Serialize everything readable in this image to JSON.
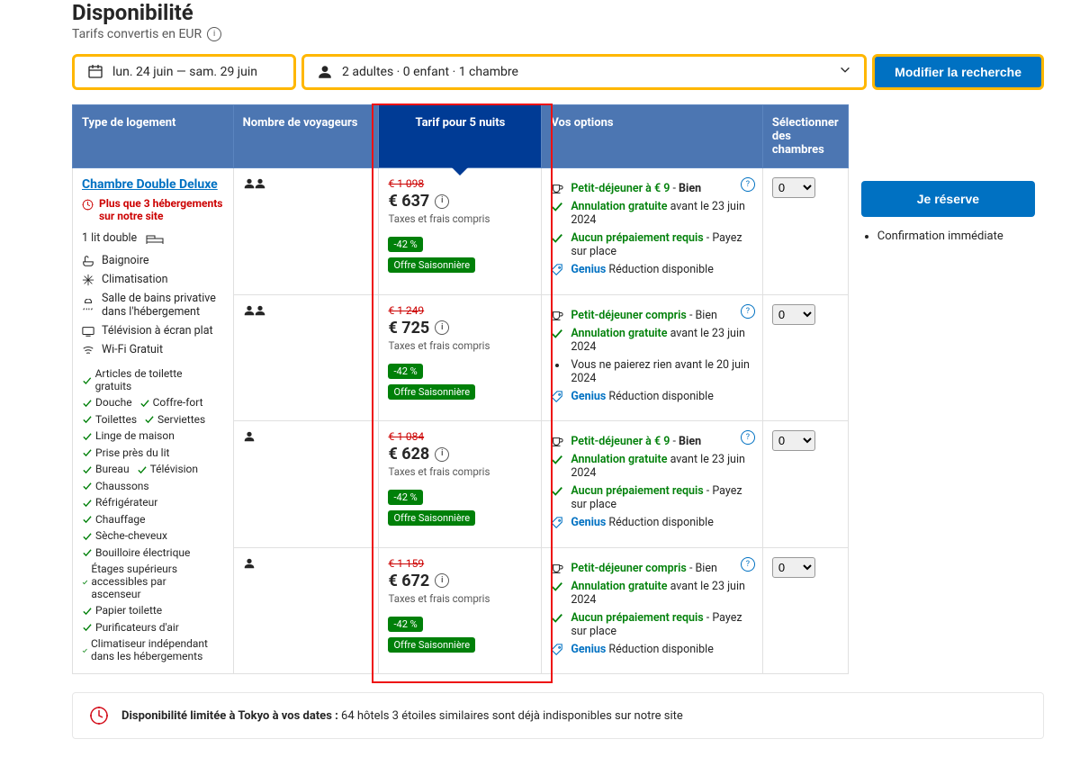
{
  "header": {
    "title": "Disponibilité",
    "subtitle": "Tarifs convertis en EUR"
  },
  "search": {
    "dates": "lun. 24 juin  —  sam. 29 juin",
    "guests": "2 adultes · 0 enfant · 1 chambre",
    "button": "Modifier la recherche"
  },
  "columns": {
    "type": "Type de logement",
    "occ": "Nombre de voyageurs",
    "price": "Tarif pour 5 nuits",
    "options": "Vos options",
    "select": "Sélectionner des chambres"
  },
  "room": {
    "name": "Chambre Double Deluxe",
    "scarcity": "Plus que 3 hébergements sur notre site",
    "bed": "1 lit double",
    "facilities": [
      "Baignoire",
      "Climatisation",
      "Salle de bains privative dans l'hébergement",
      "Télévision à écran plat",
      "Wi-Fi Gratuit"
    ],
    "amenities": [
      "Articles de toilette gratuits",
      "Douche",
      "Coffre-fort",
      "Toilettes",
      "Serviettes",
      "Linge de maison",
      "Prise près du lit",
      "Bureau",
      "Télévision",
      "Chaussons",
      "Réfrigérateur",
      "Chauffage",
      "Sèche-cheveux",
      "Bouilloire électrique",
      "Étages supérieurs accessibles par ascenseur",
      "Papier toilette",
      "Purificateurs d'air",
      "Climatiseur indépendant dans les hébergements"
    ]
  },
  "rates": [
    {
      "occupancy": 2,
      "old": "€ 1 098",
      "now": "€ 637",
      "tax": "Taxes et frais compris",
      "discount": "-42 %",
      "deal": "Offre Saisonnière",
      "options": [
        {
          "icon": "cup",
          "green": "Petit-déjeuner à € 9",
          "plain": " - ",
          "bold": "Bien"
        },
        {
          "icon": "check",
          "green": "Annulation gratuite",
          "plain": " avant le 23 juin 2024"
        },
        {
          "icon": "check",
          "green": "Aucun prépaiement requis",
          "plain": " - Payez sur place"
        },
        {
          "icon": "tag",
          "genius": "Genius",
          "plain": " Réduction disponible"
        }
      ]
    },
    {
      "occupancy": 2,
      "old": "€ 1 249",
      "now": "€ 725",
      "tax": "Taxes et frais compris",
      "discount": "-42 %",
      "deal": "Offre Saisonnière",
      "options": [
        {
          "icon": "cup",
          "green": "Petit-déjeuner compris",
          "plain": " - Bien"
        },
        {
          "icon": "check",
          "green": "Annulation gratuite",
          "plain": " avant le 23 juin 2024"
        },
        {
          "icon": "dot",
          "plain": "Vous ne paierez rien avant le 20 juin 2024"
        },
        {
          "icon": "tag",
          "genius": "Genius",
          "plain": " Réduction disponible"
        }
      ]
    },
    {
      "occupancy": 1,
      "old": "€ 1 084",
      "now": "€ 628",
      "tax": "Taxes et frais compris",
      "discount": "-42 %",
      "deal": "Offre Saisonnière",
      "options": [
        {
          "icon": "cup",
          "green": "Petit-déjeuner à € 9",
          "plain": " - ",
          "bold": "Bien"
        },
        {
          "icon": "check",
          "green": "Annulation gratuite",
          "plain": " avant le 23 juin 2024"
        },
        {
          "icon": "check",
          "green": "Aucun prépaiement requis",
          "plain": " - Payez sur place"
        },
        {
          "icon": "tag",
          "genius": "Genius",
          "plain": " Réduction disponible"
        }
      ]
    },
    {
      "occupancy": 1,
      "old": "€ 1 159",
      "now": "€ 672",
      "tax": "Taxes et frais compris",
      "discount": "-42 %",
      "deal": "Offre Saisonnière",
      "options": [
        {
          "icon": "cup",
          "green": "Petit-déjeuner compris",
          "plain": " - Bien"
        },
        {
          "icon": "check",
          "green": "Annulation gratuite",
          "plain": " avant le 23 juin 2024"
        },
        {
          "icon": "check",
          "green": "Aucun prépaiement requis",
          "plain": " - Payez sur place"
        },
        {
          "icon": "tag",
          "genius": "Genius",
          "plain": " Réduction disponible"
        }
      ]
    }
  ],
  "reserve": {
    "button": "Je réserve",
    "confirm": "Confirmation immédiate"
  },
  "alert": {
    "bold": "Disponibilité limitée à Tokyo à vos dates : ",
    "rest": "64 hôtels 3 étoiles similaires sont déjà indisponibles sur notre site"
  }
}
